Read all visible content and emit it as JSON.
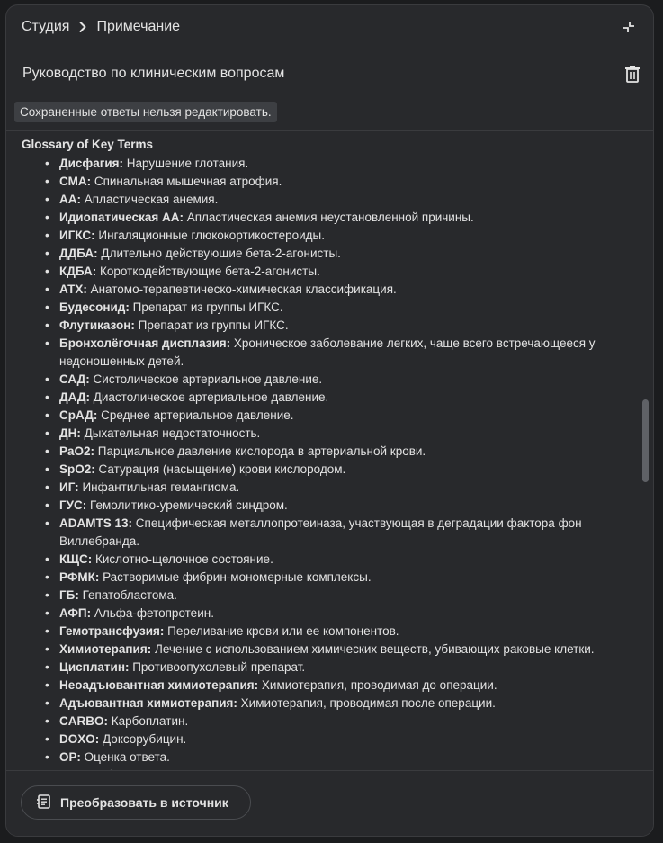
{
  "breadcrumb": {
    "root": "Студия",
    "current": "Примечание"
  },
  "note": {
    "title": "Руководство по клиническим вопросам",
    "readonly_notice": "Сохраненные ответы нельзя редактировать."
  },
  "glossary": {
    "heading": "Glossary of Key Terms",
    "terms": [
      {
        "term": "Дисфагия:",
        "definition": " Нарушение глотания."
      },
      {
        "term": "СМА:",
        "definition": " Спинальная мышечная атрофия."
      },
      {
        "term": "АА:",
        "definition": " Апластическая анемия."
      },
      {
        "term": "Идиопатическая АА:",
        "definition": " Апластическая анемия неустановленной причины."
      },
      {
        "term": "ИГКС:",
        "definition": " Ингаляционные глюкокортикостероиды."
      },
      {
        "term": "ДДБА:",
        "definition": " Длительно действующие бета-2-агонисты."
      },
      {
        "term": "КДБА:",
        "definition": " Короткодействующие бета-2-агонисты."
      },
      {
        "term": "АТХ:",
        "definition": " Анатомо-терапевтическо-химическая классификация."
      },
      {
        "term": "Будесонид:",
        "definition": " Препарат из группы ИГКС."
      },
      {
        "term": "Флутиказон:",
        "definition": " Препарат из группы ИГКС."
      },
      {
        "term": "Бронхолёгочная дисплазия:",
        "definition": " Хроническое заболевание легких, чаще всего встречающееся у недоношенных детей."
      },
      {
        "term": "САД:",
        "definition": " Систолическое артериальное давление."
      },
      {
        "term": "ДАД:",
        "definition": " Диастолическое артериальное давление."
      },
      {
        "term": "СрАД:",
        "definition": " Среднее артериальное давление."
      },
      {
        "term": "ДН:",
        "definition": " Дыхательная недостаточность."
      },
      {
        "term": "PaO2:",
        "definition": " Парциальное давление кислорода в артериальной крови."
      },
      {
        "term": "SpO2:",
        "definition": " Сатурация (насыщение) крови кислородом."
      },
      {
        "term": "ИГ:",
        "definition": " Инфантильная гемангиома."
      },
      {
        "term": "ГУС:",
        "definition": " Гемолитико-уремический синдром."
      },
      {
        "term": "ADAMTS 13:",
        "definition": " Специфическая металлопротеиназа, участвующая в деградации фактора фон Виллебранда."
      },
      {
        "term": "КЩС:",
        "definition": " Кислотно-щелочное состояние."
      },
      {
        "term": "РФМК:",
        "definition": " Растворимые фибрин-мономерные комплексы."
      },
      {
        "term": "ГБ:",
        "definition": " Гепатобластома."
      },
      {
        "term": "АФП:",
        "definition": " Альфа-фетопротеин."
      },
      {
        "term": "Гемотрансфузия:",
        "definition": " Переливание крови или ее компонентов."
      },
      {
        "term": "Химиотерапия:",
        "definition": " Лечение с использованием химических веществ, убивающих раковые клетки."
      },
      {
        "term": "Цисплатин:",
        "definition": " Противоопухолевый препарат."
      },
      {
        "term": "Неоадъювантная химиотерапия:",
        "definition": " Химиотерапия, проводимая до операции."
      },
      {
        "term": "Адъювантная химиотерапия:",
        "definition": " Химиотерапия, проводимая после операции."
      },
      {
        "term": "CARBO:",
        "definition": " Карбоплатин."
      },
      {
        "term": "DOXO:",
        "definition": " Доксорубицин."
      },
      {
        "term": "ОР:",
        "definition": " Оценка ответа."
      },
      {
        "term": "Резектабельность:",
        "definition": " Возможность полного удаления опухоли хирургическим путем."
      }
    ]
  },
  "actions": {
    "convert_label": "Преобразовать в источник"
  },
  "icons": {
    "breadcrumb_separator": "chevron-right-icon",
    "collapse": "collapse-icon",
    "delete": "trash-icon",
    "convert": "note-convert-icon"
  },
  "colors": {
    "panel_bg": "#28292c",
    "page_bg": "#1b1c1e",
    "text": "#e3e3e3",
    "chip_bg": "#3d3f43"
  }
}
